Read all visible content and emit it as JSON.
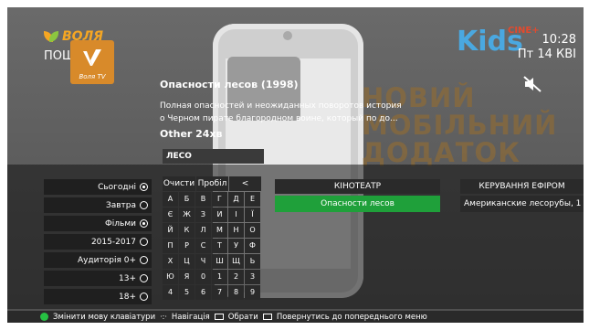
{
  "header": {
    "brand": "ВОЛЯ",
    "section": "ПОШУК",
    "time": "10:28",
    "date": "Пт 14 КВІ",
    "channel_logo": "Kids",
    "channel_badge": "CINE+"
  },
  "app_icon": {
    "label": "Воля TV"
  },
  "program": {
    "title": "Опасности лесов  (1998)",
    "description_line1": "Полная опасностей и неожиданных поворотов история",
    "description_line2": "о Черном пирате  благородном воине, который по до...",
    "meta": "Other   24хв"
  },
  "promo": {
    "line1": "НОВИЙ",
    "line2": "МОБІЛЬНИЙ",
    "line3": "ДОДАТОК"
  },
  "search": {
    "value": "ЛЕСО"
  },
  "filters": [
    {
      "label": "Сьогодні",
      "selected": true
    },
    {
      "label": "Завтра",
      "selected": false
    },
    {
      "label": "Фільми",
      "selected": true
    },
    {
      "label": "2015-2017",
      "selected": false
    },
    {
      "label": "Аудиторія 0+",
      "selected": false
    },
    {
      "label": "13+",
      "selected": false
    },
    {
      "label": "18+",
      "selected": false
    }
  ],
  "keyboard": {
    "clear": "Очисти",
    "space": "Пробіл",
    "back": "<",
    "keys": [
      "А",
      "Б",
      "В",
      "Г",
      "Д",
      "Е",
      "Є",
      "Ж",
      "З",
      "И",
      "І",
      "Ї",
      "Й",
      "К",
      "Л",
      "М",
      "Н",
      "О",
      "П",
      "Р",
      "С",
      "Т",
      "У",
      "Ф",
      "Х",
      "Ц",
      "Ч",
      "Ш",
      "Щ",
      "Ь",
      "Ю",
      "Я",
      "0",
      "1",
      "2",
      "3",
      "4",
      "5",
      "6",
      "7",
      "8",
      "9"
    ]
  },
  "columns": {
    "cinema": {
      "header": "КІНОТЕАТР",
      "result": "Опасности лесов"
    },
    "broadcast": {
      "header": "КЕРУВАННЯ ЕФІРОМ",
      "result": "Американские лесорубы, 1 с"
    }
  },
  "footer": {
    "change_lang": "Змінити мову клавіатури",
    "navigation": "Навігація",
    "select": "Обрати",
    "back": "Повернутись до попереднього меню"
  },
  "colors": {
    "accent_green": "#1fa03a",
    "brand_orange": "#f5a623"
  }
}
